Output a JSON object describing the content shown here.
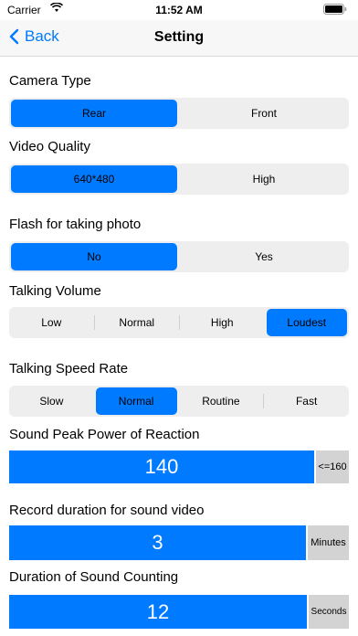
{
  "status": {
    "carrier": "Carrier",
    "time": "11:52 AM"
  },
  "nav": {
    "back_label": "Back",
    "title": "Setting"
  },
  "camera_type": {
    "label": "Camera Type",
    "options": [
      "Rear",
      "Front"
    ],
    "selected": "Rear"
  },
  "video_quality": {
    "label": "Video Quality",
    "options": [
      "640*480",
      "High"
    ],
    "selected": "640*480"
  },
  "flash": {
    "label": "Flash for taking photo",
    "options": [
      "No",
      "Yes"
    ],
    "selected": "No"
  },
  "talking_volume": {
    "label": "Talking Volume",
    "options": [
      "Low",
      "Normal",
      "High",
      "Loudest"
    ],
    "selected": "Loudest"
  },
  "talking_speed": {
    "label": "Talking Speed Rate",
    "options": [
      "Slow",
      "Normal",
      "Routine",
      "Fast"
    ],
    "selected": "Normal"
  },
  "sound_peak": {
    "label": "Sound Peak Power of Reaction",
    "value": "140",
    "unit": "<=160"
  },
  "record_duration": {
    "label": "Record duration for sound video",
    "value": "3",
    "unit": "Minutes"
  },
  "sound_counting": {
    "label": "Duration of Sound Counting",
    "value": "12",
    "unit": "Seconds"
  },
  "colors": {
    "accent": "#007aff",
    "segment_bg": "#eeeeee",
    "unit_bg": "#d3d3d3"
  }
}
